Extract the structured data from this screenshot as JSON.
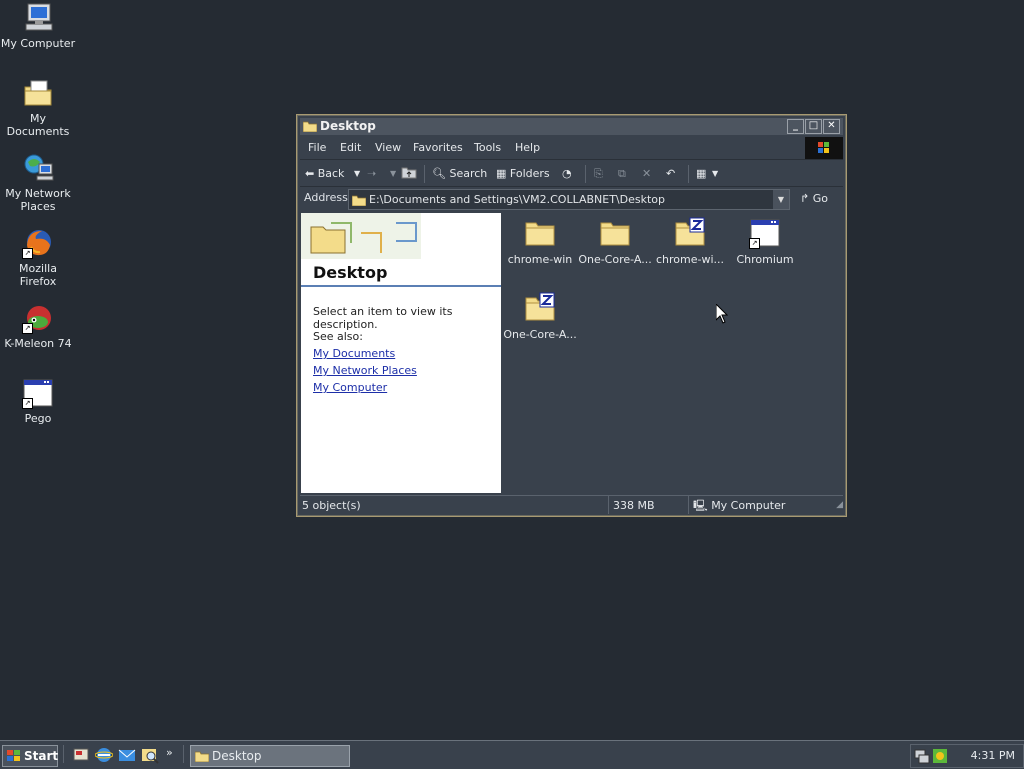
{
  "desktop": {
    "icons": [
      {
        "label": "My Computer",
        "icon": "computer-icon"
      },
      {
        "label": "My Documents",
        "icon": "documents-folder-icon"
      },
      {
        "label": "My Network Places",
        "icon": "network-places-icon"
      },
      {
        "label": "Mozilla Firefox",
        "icon": "firefox-icon"
      },
      {
        "label": "K-Meleon 74",
        "icon": "kmeleon-icon"
      },
      {
        "label": "Pego",
        "icon": "application-window-icon"
      }
    ]
  },
  "window": {
    "title": "Desktop",
    "menu": [
      "File",
      "Edit",
      "View",
      "Favorites",
      "Tools",
      "Help"
    ],
    "toolbar": {
      "back_label": "Back",
      "search_label": "Search",
      "folders_label": "Folders"
    },
    "address": {
      "label": "Address",
      "value": "E:\\Documents and Settings\\VM2.COLLABNET\\Desktop",
      "go_label": "Go"
    },
    "left_pane": {
      "title": "Desktop",
      "description": "Select an item to view its description.",
      "see_also_label": "See also:",
      "links": [
        "My Documents",
        "My Network Places",
        "My Computer"
      ]
    },
    "items": [
      {
        "label": "chrome-win",
        "icon": "folder-icon"
      },
      {
        "label": "One-Core-A...",
        "icon": "folder-icon"
      },
      {
        "label": "chrome-wi...",
        "icon": "zip-folder-icon"
      },
      {
        "label": "Chromium",
        "icon": "application-window-icon"
      },
      {
        "label": "One-Core-A...",
        "icon": "zip-folder-icon"
      }
    ],
    "status": {
      "objects": "5 object(s)",
      "size": "338 MB",
      "location": "My Computer"
    }
  },
  "taskbar": {
    "start_label": "Start",
    "task_label": "Desktop",
    "clock": "4:31 PM"
  },
  "colors": {
    "desktop_bg": "#252b33",
    "window_bg": "#39414c",
    "link": "#1d2fa8",
    "folder": "#f3dc8a"
  }
}
